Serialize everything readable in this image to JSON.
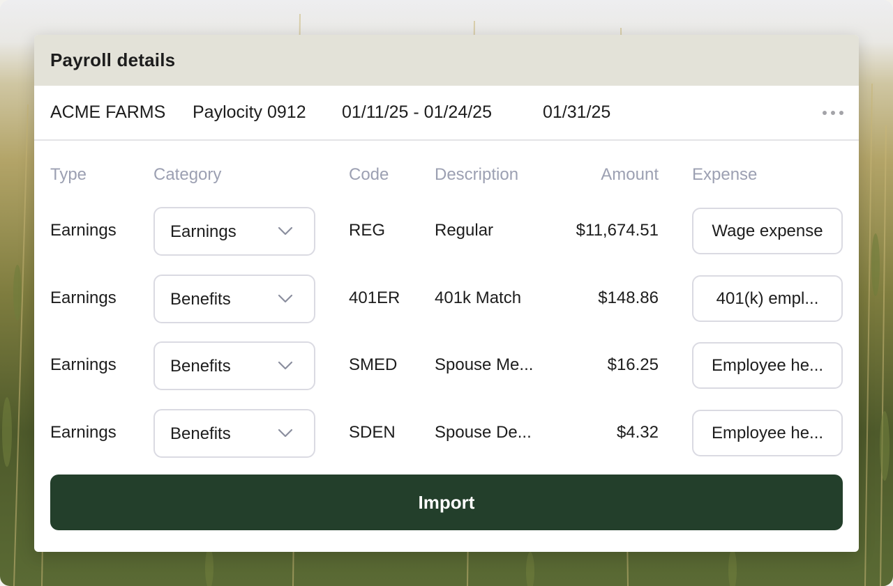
{
  "card": {
    "title": "Payroll details"
  },
  "meta": {
    "company": "ACME FARMS",
    "payroll_id": "Paylocity 0912",
    "period": "01/11/25 - 01/24/25",
    "pay_date": "01/31/25"
  },
  "columns": {
    "type": "Type",
    "category": "Category",
    "code": "Code",
    "description": "Description",
    "amount": "Amount",
    "expense": "Expense"
  },
  "rows": [
    {
      "type": "Earnings",
      "category": "Earnings",
      "code": "REG",
      "description": "Regular",
      "amount": "$11,674.51",
      "expense": "Wage expense"
    },
    {
      "type": "Earnings",
      "category": "Benefits",
      "code": "401ER",
      "description": "401k Match",
      "amount": "$148.86",
      "expense": "401(k) empl..."
    },
    {
      "type": "Earnings",
      "category": "Benefits",
      "code": "SMED",
      "description": "Spouse Me...",
      "amount": "$16.25",
      "expense": "Employee he..."
    },
    {
      "type": "Earnings",
      "category": "Benefits",
      "code": "SDEN",
      "description": "Spouse De...",
      "amount": "$4.32",
      "expense": "Employee he..."
    }
  ],
  "actions": {
    "import_label": "Import"
  },
  "icons": {
    "more": "more-horizontal-icon",
    "chevron": "chevron-down-icon"
  },
  "colors": {
    "header_bg": "#e3e2d8",
    "button_bg": "#233f2b",
    "muted_text": "#9ca0b2"
  }
}
